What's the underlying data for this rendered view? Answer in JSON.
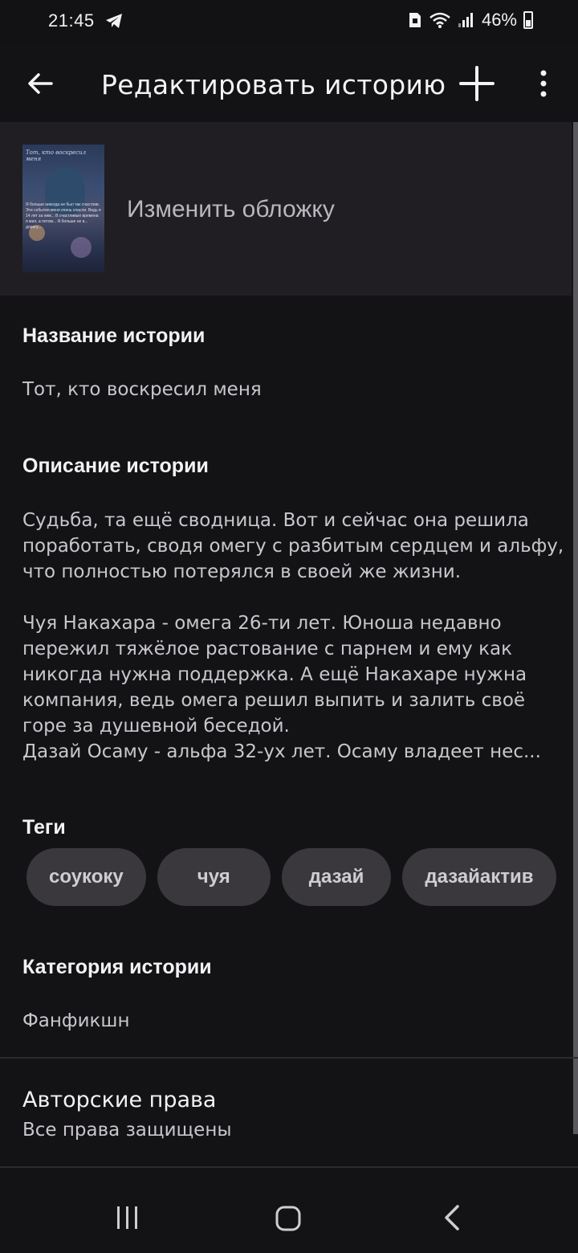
{
  "status_bar": {
    "time": "21:45",
    "battery": "46%"
  },
  "app_bar": {
    "title": "Редактировать историю"
  },
  "cover": {
    "label": "Изменить обложку",
    "thumb_title": "Тот, кто воскресил меня",
    "thumb_text": "Я больше никогда не был так счастлив. Эти события меня очень спасли. Ведь я 14 лет за ним... В счастливые времена я жил, а потом... Я больше не в... дорогу..."
  },
  "story_title": {
    "heading": "Название истории",
    "value": "Тот, кто воскресил меня"
  },
  "story_description": {
    "heading": "Описание истории",
    "value": "Судьба, та ещё сводница. Вот и сейчас она решила поработать, сводя омегу с разбитым сердцем и альфу, что полностью потерялся в своей же жизни.\n\nЧуя Накахара - омега 26-ти лет. Юноша недавно пережил тяжёлое растование с парнем и ему как никогда нужна поддержка. А ещё Накахаре нужна компания, ведь омега решил выпить и залить своё горе за душевной беседой.\nДазай Осаму - альфа 32-ух лет. Осаму владеет нес..."
  },
  "tags": {
    "heading": "Теги",
    "items": [
      "соукоку",
      "чуя",
      "дазай",
      "дазайактив"
    ]
  },
  "category": {
    "heading": "Категория истории",
    "value": "Фанфикшн"
  },
  "copyright": {
    "heading": "Авторские права",
    "value": "Все права защищены"
  }
}
